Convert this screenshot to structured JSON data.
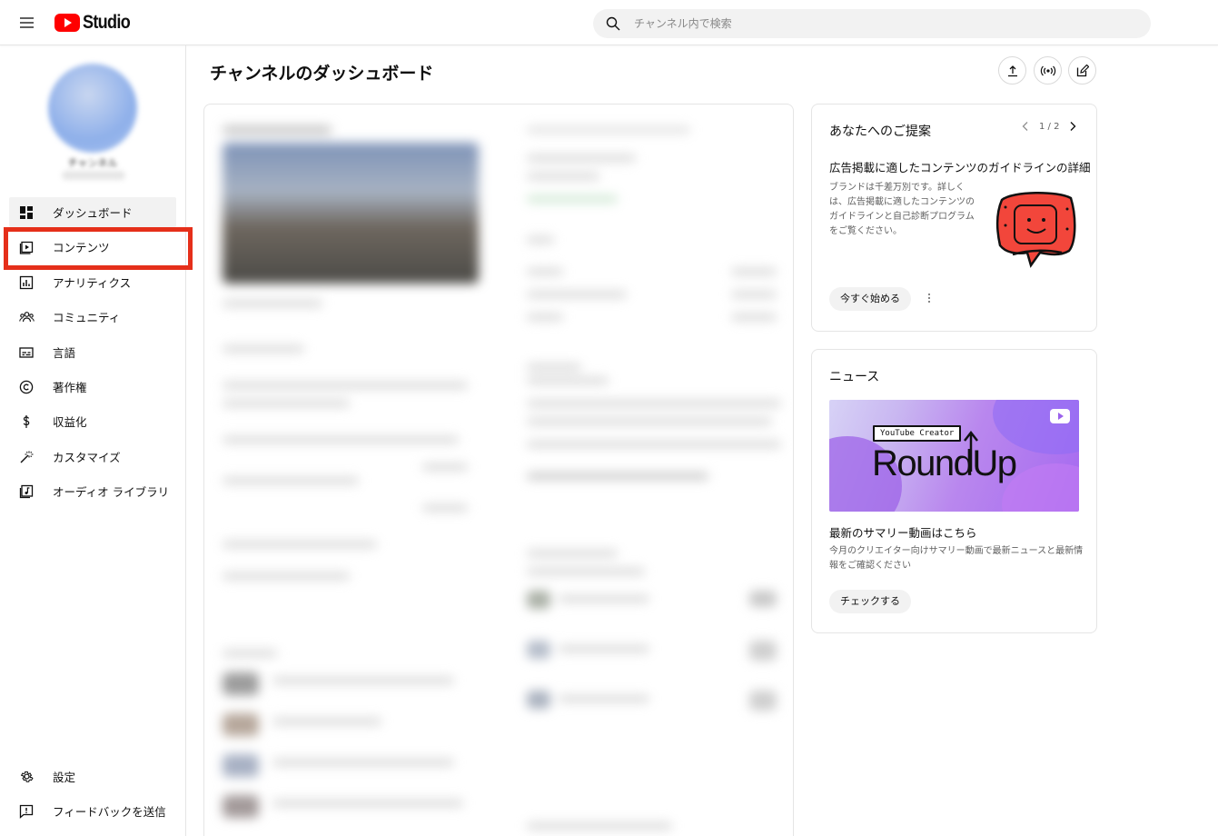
{
  "header": {
    "app_name": "Studio",
    "search_placeholder": "チャンネル内で検索"
  },
  "sidebar": {
    "channel_name": "チャンネル",
    "items": [
      {
        "label": "ダッシュボード",
        "icon": "dashboard-icon",
        "active": true
      },
      {
        "label": "コンテンツ",
        "icon": "content-icon"
      },
      {
        "label": "アナリティクス",
        "icon": "analytics-icon"
      },
      {
        "label": "コミュニティ",
        "icon": "community-icon"
      },
      {
        "label": "言語",
        "icon": "subtitles-icon"
      },
      {
        "label": "著作権",
        "icon": "copyright-icon"
      },
      {
        "label": "収益化",
        "icon": "dollar-icon"
      },
      {
        "label": "カスタマイズ",
        "icon": "magic-wand-icon"
      },
      {
        "label": "オーディオ ライブラリ",
        "icon": "audio-library-icon"
      }
    ],
    "bottom": [
      {
        "label": "設定",
        "icon": "gear-icon"
      },
      {
        "label": "フィードバックを送信",
        "icon": "feedback-icon"
      }
    ]
  },
  "main": {
    "title": "チャンネルのダッシュボード"
  },
  "suggestion": {
    "title": "あなたへのご提案",
    "pager": "1 / 2",
    "heading": "広告掲載に適したコンテンツのガイドラインの詳細",
    "body": "ブランドは千差万別です。詳しくは、広告掲載に適したコンテンツのガイドラインと自己診断プログラムをご覧ください。",
    "cta": "今すぐ始める"
  },
  "news": {
    "title": "ニュース",
    "image_badge": "YouTube Creator",
    "image_title": "RoundUp",
    "heading": "最新のサマリー動画はこちら",
    "body": "今月のクリエイター向けサマリー動画で最新ニュースと最新情報をご確認ください",
    "cta": "チェックする"
  },
  "colors": {
    "brand_red": "#ff0000",
    "highlight_red": "#e52f1a",
    "news_purple": "#a66af0"
  }
}
